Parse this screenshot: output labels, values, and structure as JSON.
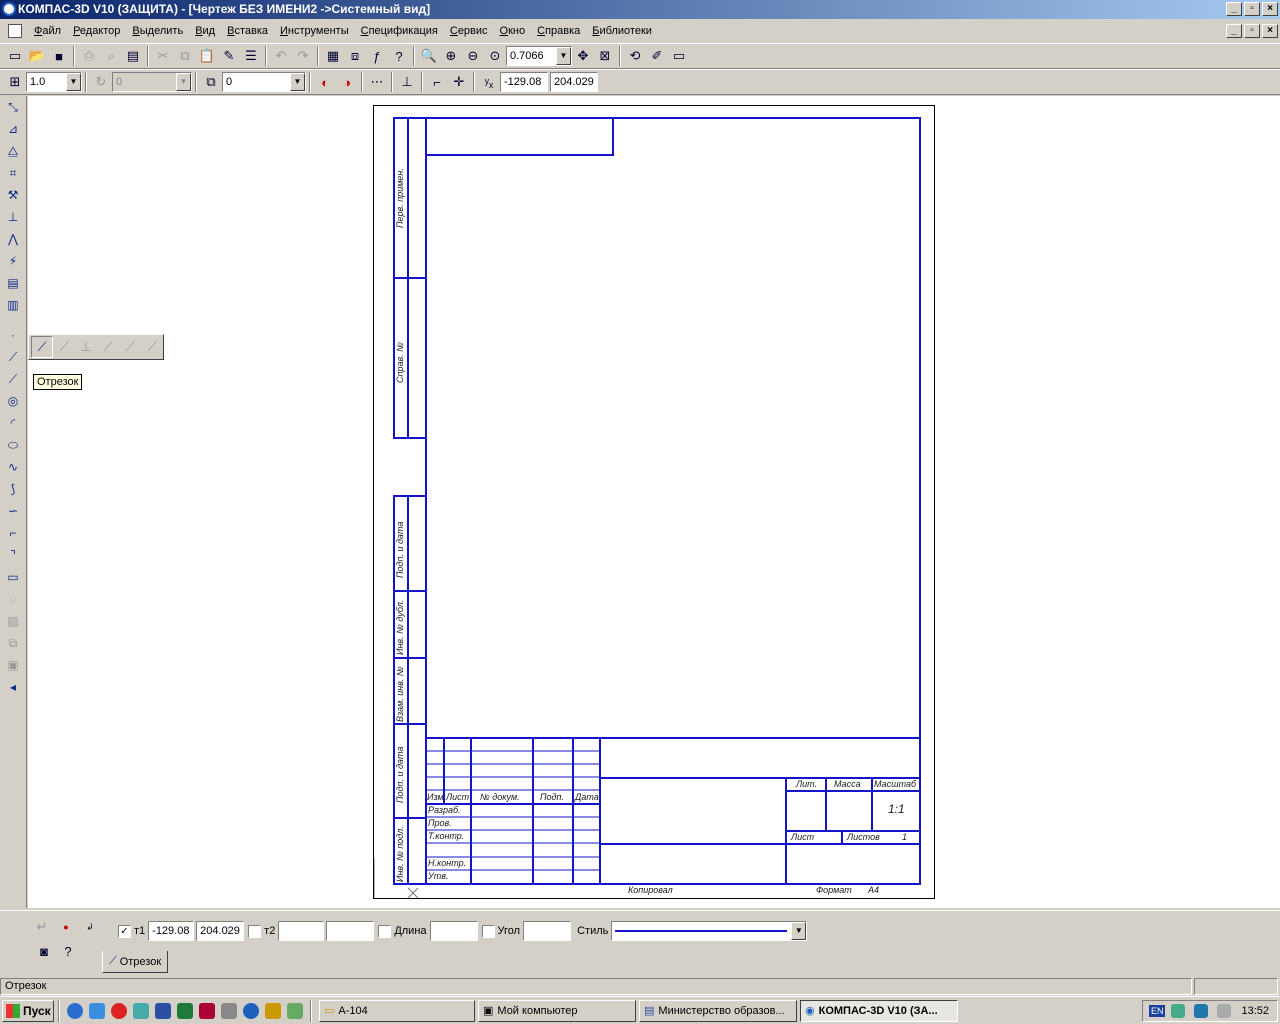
{
  "window": {
    "title": "КОМПАС-3D V10 (ЗАЩИТА) - [Чертеж БЕЗ ИМЕНИ2 ->Системный вид]",
    "min": "_",
    "max": "▫",
    "close": "×"
  },
  "menu": [
    "Файл",
    "Редактор",
    "Выделить",
    "Вид",
    "Вставка",
    "Инструменты",
    "Спецификация",
    "Сервис",
    "Окно",
    "Справка",
    "Библиотеки"
  ],
  "toolbar": {
    "zoom": "0.7066"
  },
  "toolbar2": {
    "scale": "1.0",
    "step_angle": "0",
    "layer": "0",
    "x": "-129.08",
    "y": "204.029"
  },
  "flyout": {
    "tooltip": "Отрезок"
  },
  "sheet": {
    "left_cols": [
      "Перв. примен.",
      "Справ. №",
      "Подп. и дата",
      "Инв. № дубл.",
      "Взам. инв. №",
      "Подп. и дата",
      "Инв. № подл."
    ],
    "table_header": [
      "Изм",
      "Лист",
      "№ докум.",
      "Подп.",
      "Дата"
    ],
    "table_rows": [
      "Разраб.",
      "Пров.",
      "Т.контр.",
      "",
      "Н.контр.",
      "Утв."
    ],
    "lit": "Лит.",
    "mass": "Масса",
    "scale_lbl": "Масштаб",
    "scale_val": "1:1",
    "sheet_lbl": "Лист",
    "sheets_lbl": "Листов",
    "sheets_val": "1",
    "copied": "Копировал",
    "format_lbl": "Формат",
    "format_val": "А4"
  },
  "props": {
    "t1_label": "т1",
    "t1_x": "-129.08",
    "t1_y": "204.029",
    "t2_label": "т2",
    "length_label": "Длина",
    "angle_label": "Угол",
    "style_label": "Стиль",
    "tab": "Отрезок"
  },
  "status": {
    "text": "Отрезок"
  },
  "taskbar": {
    "start": "Пуск",
    "tasks": [
      "А-104",
      "Мой компьютер",
      "Министерство образов...",
      "КОМПАС-3D V10 (ЗА..."
    ],
    "lang": "EN",
    "time": "13:52"
  }
}
